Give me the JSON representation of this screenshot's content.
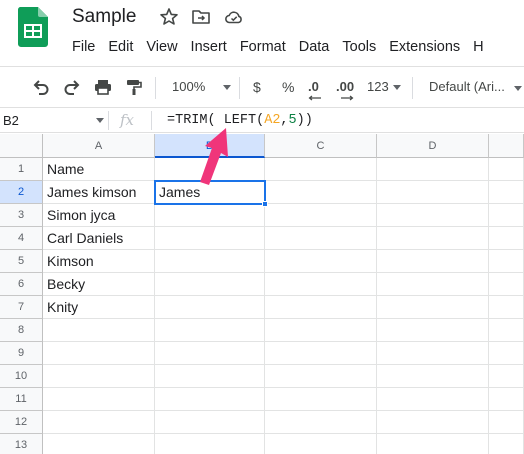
{
  "app": {
    "doc_title": "Sample",
    "menu": [
      "File",
      "Edit",
      "View",
      "Insert",
      "Format",
      "Data",
      "Tools",
      "Extensions",
      "H"
    ]
  },
  "toolbar": {
    "zoom": "100%",
    "currency": "$",
    "percent": "%",
    "decrease_decimal": ".0",
    "increase_decimal": ".00",
    "more_formats": "123",
    "font": "Default (Ari..."
  },
  "formula_bar": {
    "name_box": "B2",
    "fx": "fx",
    "formula_prefix": "=TRIM( LEFT(",
    "formula_ref": "A2",
    "formula_comma": ",",
    "formula_num": "5",
    "formula_suffix": "))"
  },
  "grid": {
    "columns": [
      "A",
      "B",
      "C",
      "D"
    ],
    "rows": [
      "1",
      "2",
      "3",
      "4",
      "5",
      "6",
      "7",
      "8",
      "9",
      "10",
      "11",
      "12",
      "13"
    ],
    "cells": {
      "A1": "Name",
      "A2": "James kimson",
      "A3": "Simon jyca",
      "A4": "Carl Daniels",
      "A5": "Kimson",
      "A6": "Becky",
      "A7": "Knity",
      "B2": "James"
    },
    "selected_cell": "B2"
  },
  "colors": {
    "selection": "#1a73e8",
    "arrow": "#f0357a",
    "logo_green": "#0f9d58"
  },
  "icons": [
    "sheets-logo-icon",
    "star-icon",
    "move-to-folder-icon",
    "cloud-saved-icon",
    "undo-icon",
    "redo-icon",
    "print-icon",
    "paint-format-icon"
  ]
}
